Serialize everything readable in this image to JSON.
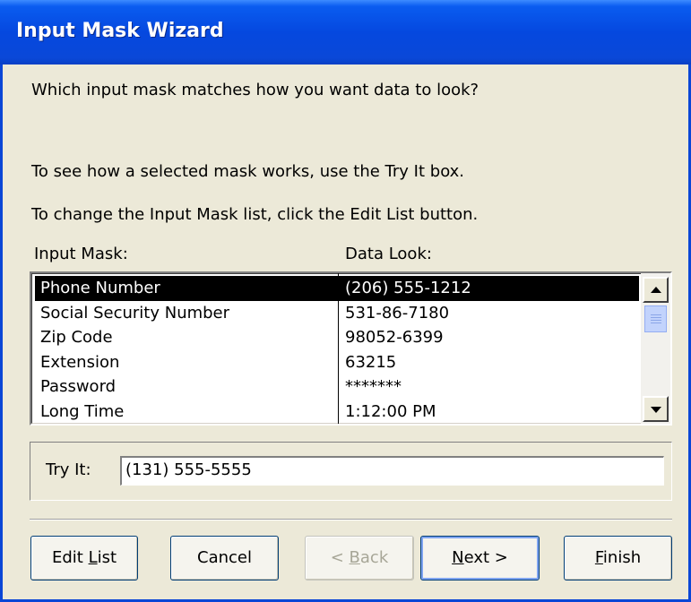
{
  "window": {
    "title": "Input Mask Wizard"
  },
  "prompt": {
    "question": "Which input mask matches how you want data to look?",
    "hint_try": "To see how a selected mask works, use the Try It box.",
    "hint_edit": "To change the Input Mask list, click the Edit List button."
  },
  "list": {
    "col_mask": "Input Mask:",
    "col_look": "Data Look:",
    "rows": [
      {
        "mask": "Phone Number",
        "look": "(206) 555-1212",
        "selected": true
      },
      {
        "mask": "Social Security Number",
        "look": "531-86-7180"
      },
      {
        "mask": "Zip Code",
        "look": "98052-6399"
      },
      {
        "mask": "Extension",
        "look": "63215"
      },
      {
        "mask": "Password",
        "look": "*******"
      },
      {
        "mask": "Long Time",
        "look": "1:12:00 PM"
      }
    ]
  },
  "tryit": {
    "label": "Try It:",
    "value": "(131) 555-5555"
  },
  "buttons": {
    "edit_list_pre": "Edit ",
    "edit_list_key": "L",
    "edit_list_post": "ist",
    "cancel": "Cancel",
    "back_pre": "< ",
    "back_key": "B",
    "back_post": "ack",
    "next_key": "N",
    "next_post": "ext >",
    "finish_key": "F",
    "finish_post": "inish"
  },
  "icons": {
    "scroll_up": "up-arrow-icon",
    "scroll_down": "down-arrow-icon",
    "scroll_thumb": "scroll-thumb-grip"
  }
}
